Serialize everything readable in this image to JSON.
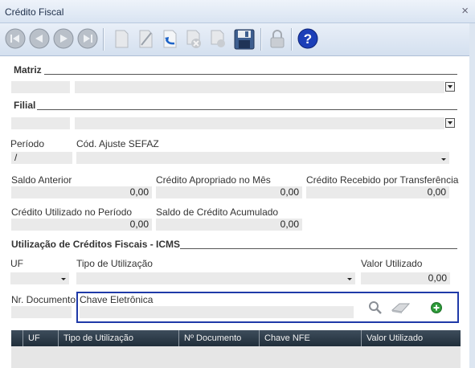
{
  "window": {
    "title": "Crédito Fiscal",
    "close_glyph": "×"
  },
  "toolbar": {
    "buttons": [
      {
        "name": "first-record-button",
        "icon": "first-icon"
      },
      {
        "name": "previous-record-button",
        "icon": "previous-icon"
      },
      {
        "name": "next-record-button",
        "icon": "next-icon"
      },
      {
        "name": "last-record-button",
        "icon": "last-icon"
      },
      {
        "name": "new-button",
        "icon": "new-document-icon"
      },
      {
        "name": "edit-button",
        "icon": "edit-icon"
      },
      {
        "name": "confirm-button",
        "icon": "confirm-icon"
      },
      {
        "name": "cancel-button",
        "icon": "cancel-icon"
      },
      {
        "name": "delete-button",
        "icon": "delete-icon"
      },
      {
        "name": "save-button",
        "icon": "save-icon"
      },
      {
        "name": "lock-button",
        "icon": "lock-icon"
      },
      {
        "name": "help-button",
        "icon": "help-icon"
      }
    ],
    "help_glyph": "?"
  },
  "matriz": {
    "title": "Matriz",
    "code": "",
    "name": ""
  },
  "filial": {
    "title": "Filial",
    "code": "",
    "name": ""
  },
  "periodo": {
    "label": "Período",
    "value": "/"
  },
  "cod_ajuste": {
    "label": "Cód. Ajuste SEFAZ",
    "value": ""
  },
  "saldos": {
    "saldo_anterior": {
      "label": "Saldo Anterior",
      "value": "0,00"
    },
    "credito_apropriado": {
      "label": "Crédito Apropriado no Mês",
      "value": "0,00"
    },
    "credito_recebido": {
      "label": "Crédito Recebido por Transferência",
      "value": "0,00"
    },
    "credito_utilizado": {
      "label": "Crédito Utilizado no Período",
      "value": "0,00"
    },
    "saldo_acumulado": {
      "label": "Saldo de Crédito Acumulado",
      "value": "0,00"
    }
  },
  "utilizacao": {
    "title": "Utilização de Créditos Fiscais - ICMS",
    "uf": {
      "label": "UF",
      "value": ""
    },
    "tipo": {
      "label": "Tipo de Utilização",
      "value": ""
    },
    "valor": {
      "label": "Valor Utilizado",
      "value": "0,00"
    },
    "nr_documento": {
      "label": "Nr. Documento",
      "value": ""
    },
    "chave": {
      "label": "Chave Eletrônica",
      "value": ""
    }
  },
  "grid": {
    "columns": [
      "UF",
      "Tipo de Utilização",
      "Nº Documento",
      "Chave NFE",
      "Valor Utilizado"
    ]
  },
  "colors": {
    "highlight_border": "#1f3aa8",
    "grid_header": "#2c3a48",
    "add_icon": "#2e9b3a",
    "help_icon": "#1c3fb8"
  }
}
